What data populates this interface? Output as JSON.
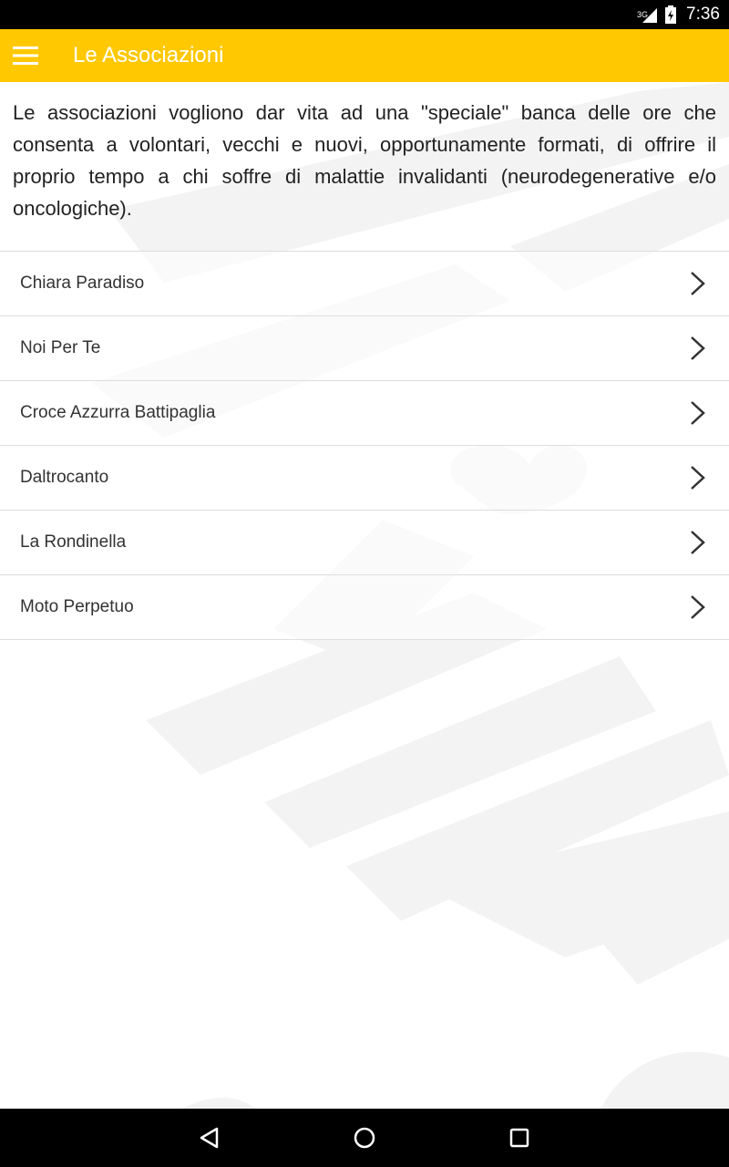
{
  "status_bar": {
    "network": "3G",
    "time": "7:36"
  },
  "app_bar": {
    "title": "Le Associazioni",
    "menu_icon": "hamburger-menu-icon",
    "background_color": "#ffc800"
  },
  "intro_text": "Le associazioni vogliono dar vita ad una \"speciale\" banca delle ore che consenta a volontari, vecchi e nuovi, opportunamente formati, di offrire il proprio tempo a chi soffre di malattie invalidanti (neurodegenerative e/o oncologiche).",
  "associations": [
    {
      "label": "Chiara Paradiso"
    },
    {
      "label": "Noi Per Te"
    },
    {
      "label": "Croce Azzurra Battipaglia"
    },
    {
      "label": "Daltrocanto"
    },
    {
      "label": "La Rondinella"
    },
    {
      "label": "Moto Perpetuo"
    }
  ],
  "nav_bar": {
    "back_icon": "back-triangle-icon",
    "home_icon": "home-circle-icon",
    "recents_icon": "recents-square-icon"
  }
}
